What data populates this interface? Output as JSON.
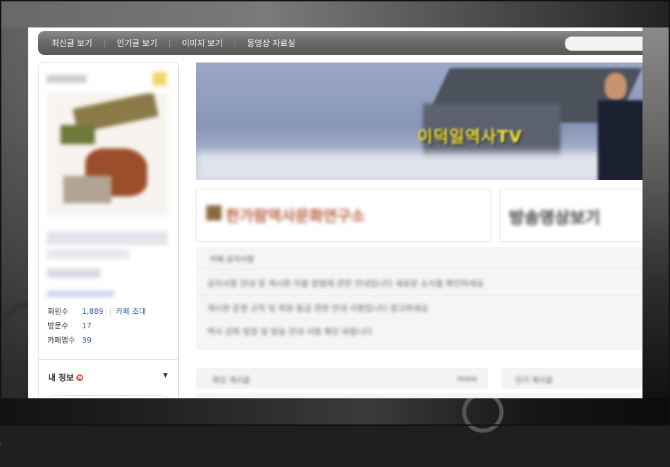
{
  "nav": {
    "items": [
      "최신글 보기",
      "인기글 보기",
      "이미지 보기",
      "동영상 자료실"
    ]
  },
  "sidebar": {
    "stats": [
      {
        "label": "회원수",
        "value": "1,889",
        "extra": "카페 초대"
      },
      {
        "label": "방문수",
        "value": "17"
      },
      {
        "label": "카페앱수",
        "value": "39"
      }
    ],
    "my_info": "내 정보",
    "new_badge": "N"
  },
  "banner": {
    "title": "이덕일역사TV"
  },
  "cards": {
    "left_text": "한가람역사문화연구소",
    "right_text": "방송영상보기"
  },
  "notice": {
    "head": "카페 공지사항",
    "rows": [
      "공지사항 안내 및 게시판 이용 방법에 관한 안내입니다 새로운 소식을 확인하세요",
      "게시판 운영 규칙 및 회원 등급 관련 안내 사항입니다 참고하세요",
      "역사 강좌 일정 및 방송 안내 사항 확인 바랍니다"
    ]
  },
  "boards": {
    "left_title": "최신 게시글",
    "left_more": "more",
    "right_title": "인기 게시글"
  },
  "colors": {
    "nav_bg": "#6a6a6a",
    "link_blue": "#3a5fa8",
    "new_dot": "#e8533f",
    "banner_title": "#f3e53a"
  }
}
